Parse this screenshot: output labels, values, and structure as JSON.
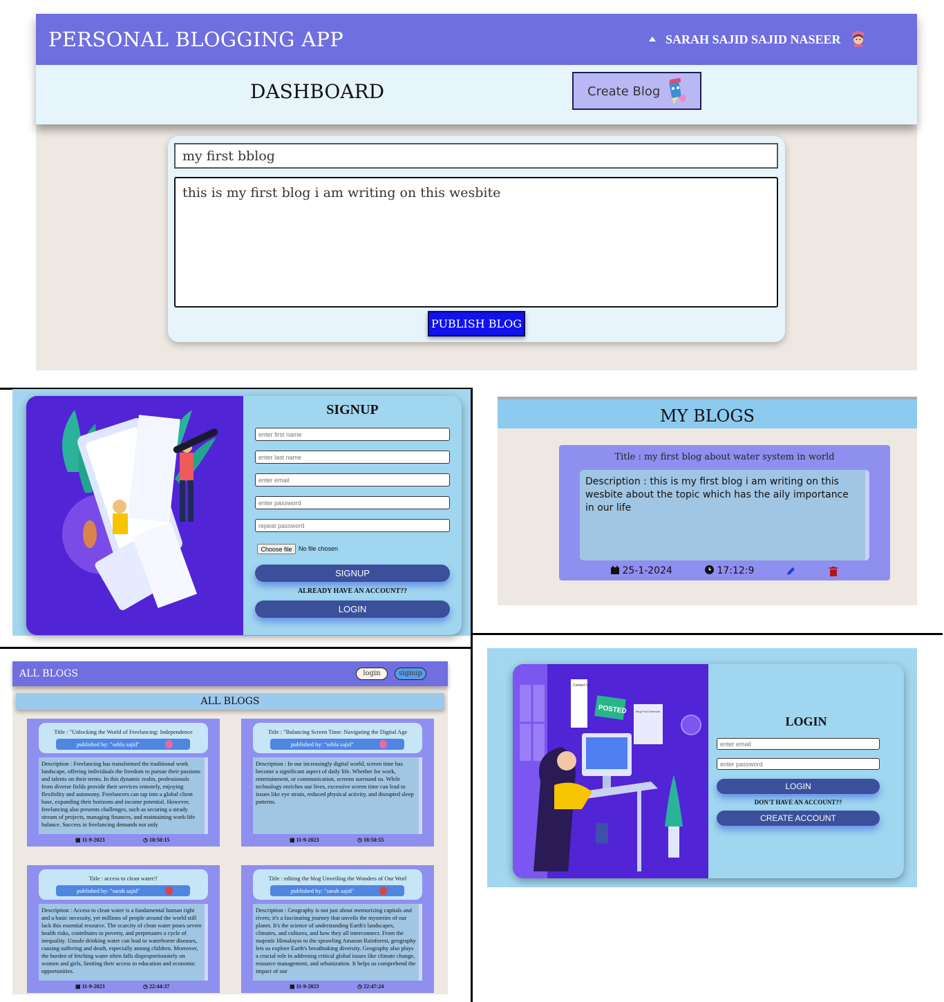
{
  "dashboard": {
    "app_title": "PERSONAL BLOGGING APP",
    "username": "SARAH SAJID SAJID NASEER",
    "page_title": "DASHBOARD",
    "create_blog_label": "Create Blog",
    "title_value": "my first bblog",
    "body_value": "this is my first blog i am writing on this wesbite",
    "publish_label": "PUBLISH BLOG"
  },
  "signup": {
    "title": "SIGNUP",
    "first_name_placeholder": "enter first name",
    "last_name_placeholder": "enter last name",
    "email_placeholder": "enter email",
    "password_placeholder": "enter password",
    "repeat_password_placeholder": "repeat password",
    "choose_file_label": "Choose file",
    "no_file_text": "No file chosen",
    "signup_button": "SIGNUP",
    "already_account": "ALREADY HAVE AN ACCOUNT??",
    "login_button": "LOGIN"
  },
  "my_blogs": {
    "heading": "MY BLOGS",
    "card": {
      "title": "Title : my first blog about water system in world",
      "description": "Description : this is my first blog i am writing on this wesbite about the topic which has the aily importance in our life",
      "date": "25-1-2024",
      "time": "17:12:9"
    }
  },
  "all_blogs": {
    "brand": "ALL BLOGS",
    "nav_login": "login",
    "nav_signup": "signup",
    "heading": "ALL BLOGS",
    "cards": [
      {
        "title": "Title : \"Unlocking the World of Freelancing: Independence",
        "publisher": "published by: \"sehla sajid\"",
        "description": "Description : Freelancing has transformed the traditional work landscape, offering individuals the freedom to pursue their passions and talents on their terms. In this dynamic realm, professionals from diverse fields provide their services remotely, enjoying flexibility and autonomy. Freelancers can tap into a global client base, expanding their horizons and income potential. However, freelancing also presents challenges, such as securing a steady stream of projects, managing finances, and maintaining work-life balance. Success in freelancing demands not only",
        "date": "11-9-2023",
        "time": "18:50:15"
      },
      {
        "title": "Title : \"Balancing Screen Time: Navigating the Digital Age",
        "publisher": "published by: \"sehla sajid\"",
        "description": "Description : In our increasingly digital world, screen time has become a significant aspect of daily life. Whether for work, entertainment, or communication, screens surround us. While technology enriches our lives, excessive screen time can lead to issues like eye strain, reduced physical activity, and disrupted sleep patterns.",
        "date": "11-9-2023",
        "time": "18:50:55"
      },
      {
        "title": "Title : access to clean water!!",
        "publisher": "published by: \"sarah sajid\"",
        "description": "Description : Access to clean water is a fundamental human right and a basic necessity, yet millions of people around the world still lack this essential resource. The scarcity of clean water poses severe health risks, contributes to poverty, and perpetuates a cycle of inequality. Unsafe drinking water can lead to waterborne diseases, causing suffering and death, especially among children. Moreover, the burden of fetching water often falls disproportionately on women and girls, limiting their access to education and economic opportunities.",
        "date": "11-9-2023",
        "time": "22:44:37"
      },
      {
        "title": "Title : editing the blog Unveiling the Wonders of Our Worl",
        "publisher": "published by: \"sarah sajid\"",
        "description": "Description : Geography is not just about memorizing capitals and rivers; it's a fascinating journey that unveils the mysteries of our planet. It's the science of understanding Earth's landscapes, climates, and cultures, and how they all interconnect. From the majestic Himalayas to the sprawling Amazon Rainforest, geography lets us explore Earth's breathtaking diversity. Geography also plays a crucial role in addresing critical global issues like climate change, resource management, and urbanization. It helps us comprehend the impact of our",
        "date": "11-9-2023",
        "time": "22:47:24"
      }
    ]
  },
  "login": {
    "title": "LOGIN",
    "email_placeholder": "enter email",
    "password_placeholder": "enter password",
    "login_button": "LOGIN",
    "no_account": "DON'T HAVE AN ACCOUNT??",
    "create_account_button": "CREATE ACCOUNT",
    "art_labels": {
      "posted": "POSTED",
      "contact": "Contact Us",
      "blog_post": "Blog Post Schedule"
    }
  },
  "colors": {
    "topbar": "#6f6fe0",
    "card_purple": "#8f8ff0",
    "accent_blue": "#1212ee",
    "pill_button": "#3b4f9b",
    "art_purple": "#5124d6"
  }
}
